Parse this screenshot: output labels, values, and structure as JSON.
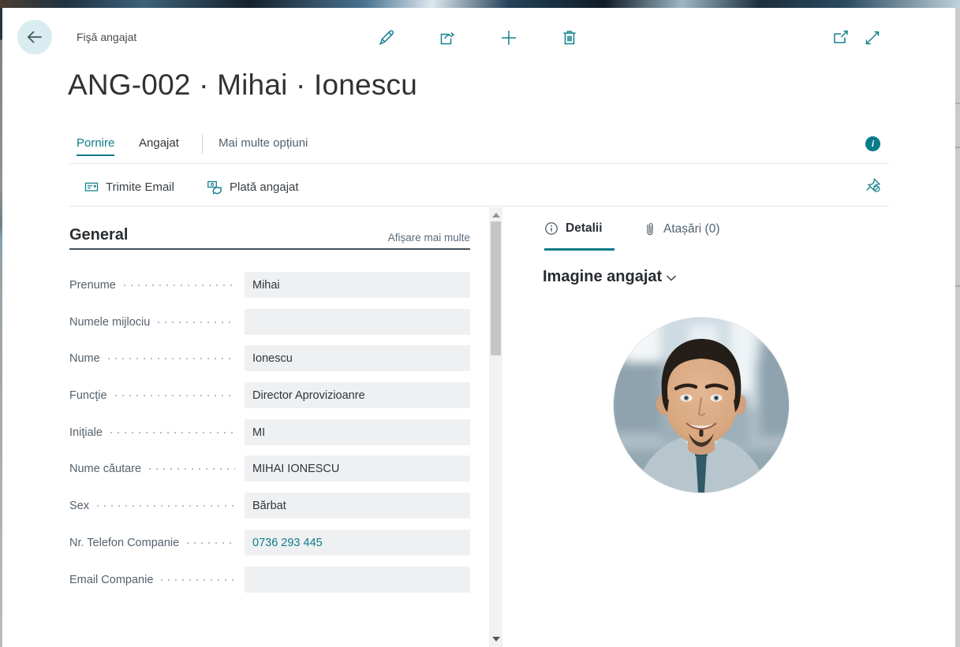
{
  "colors": {
    "accent_teal": "#0e7c87",
    "info_badge_bg": "#077c8a",
    "field_bg": "#eff0f2",
    "label_text": "#55616d",
    "value_text": "#30343a",
    "title_text": "#323232",
    "divider": "#e3e4e5",
    "back_circle_bg": "#d9ecef"
  },
  "header": {
    "caption": "Fişă angajat",
    "icons": {
      "back": "arrow-left",
      "edit": "pencil",
      "share": "box-arrow",
      "new": "plus",
      "delete": "trash",
      "open_in_window": "popout",
      "fullscreen": "diagonal-expand"
    }
  },
  "page_title": "ANG-002 · Mihai · Ionescu",
  "menu": {
    "tabs": [
      {
        "label": "Pornire",
        "active": true
      },
      {
        "label": "Angajat",
        "active": false
      }
    ],
    "more_label": "Mai multe opțiuni",
    "info_glyph": "i"
  },
  "actions": {
    "items": [
      {
        "label": "Trimite Email",
        "icon": "envelope"
      },
      {
        "label": "Plată angajat",
        "icon": "banknote-refresh"
      }
    ],
    "unpin_icon": "pin-slash"
  },
  "general": {
    "heading": "General",
    "show_more_label": "Afișare mai multe",
    "fields": [
      {
        "label": "Prenume",
        "value": "Mihai"
      },
      {
        "label": "Numele mijlociu",
        "value": ""
      },
      {
        "label": "Nume",
        "value": "Ionescu"
      },
      {
        "label": "Funcţie",
        "value": "Director Aprovizioanre"
      },
      {
        "label": "Iniţiale",
        "value": "MI"
      },
      {
        "label": "Nume căutare",
        "value": "MIHAI IONESCU"
      },
      {
        "label": "Sex",
        "value": "Bărbat"
      },
      {
        "label": "Nr. Telefon Companie",
        "value": "0736 293 445",
        "link": true
      },
      {
        "label": "Email Companie",
        "value": ""
      }
    ]
  },
  "factbox": {
    "tabs": [
      {
        "label": "Detalii",
        "icon": "info-outline",
        "active": true
      },
      {
        "label": "Atașări (0)",
        "icon": "paperclip",
        "active": false
      }
    ],
    "section_heading": "Imagine angajat",
    "collapse_icon": "chevron-down",
    "image_alt": "employee-photo"
  }
}
